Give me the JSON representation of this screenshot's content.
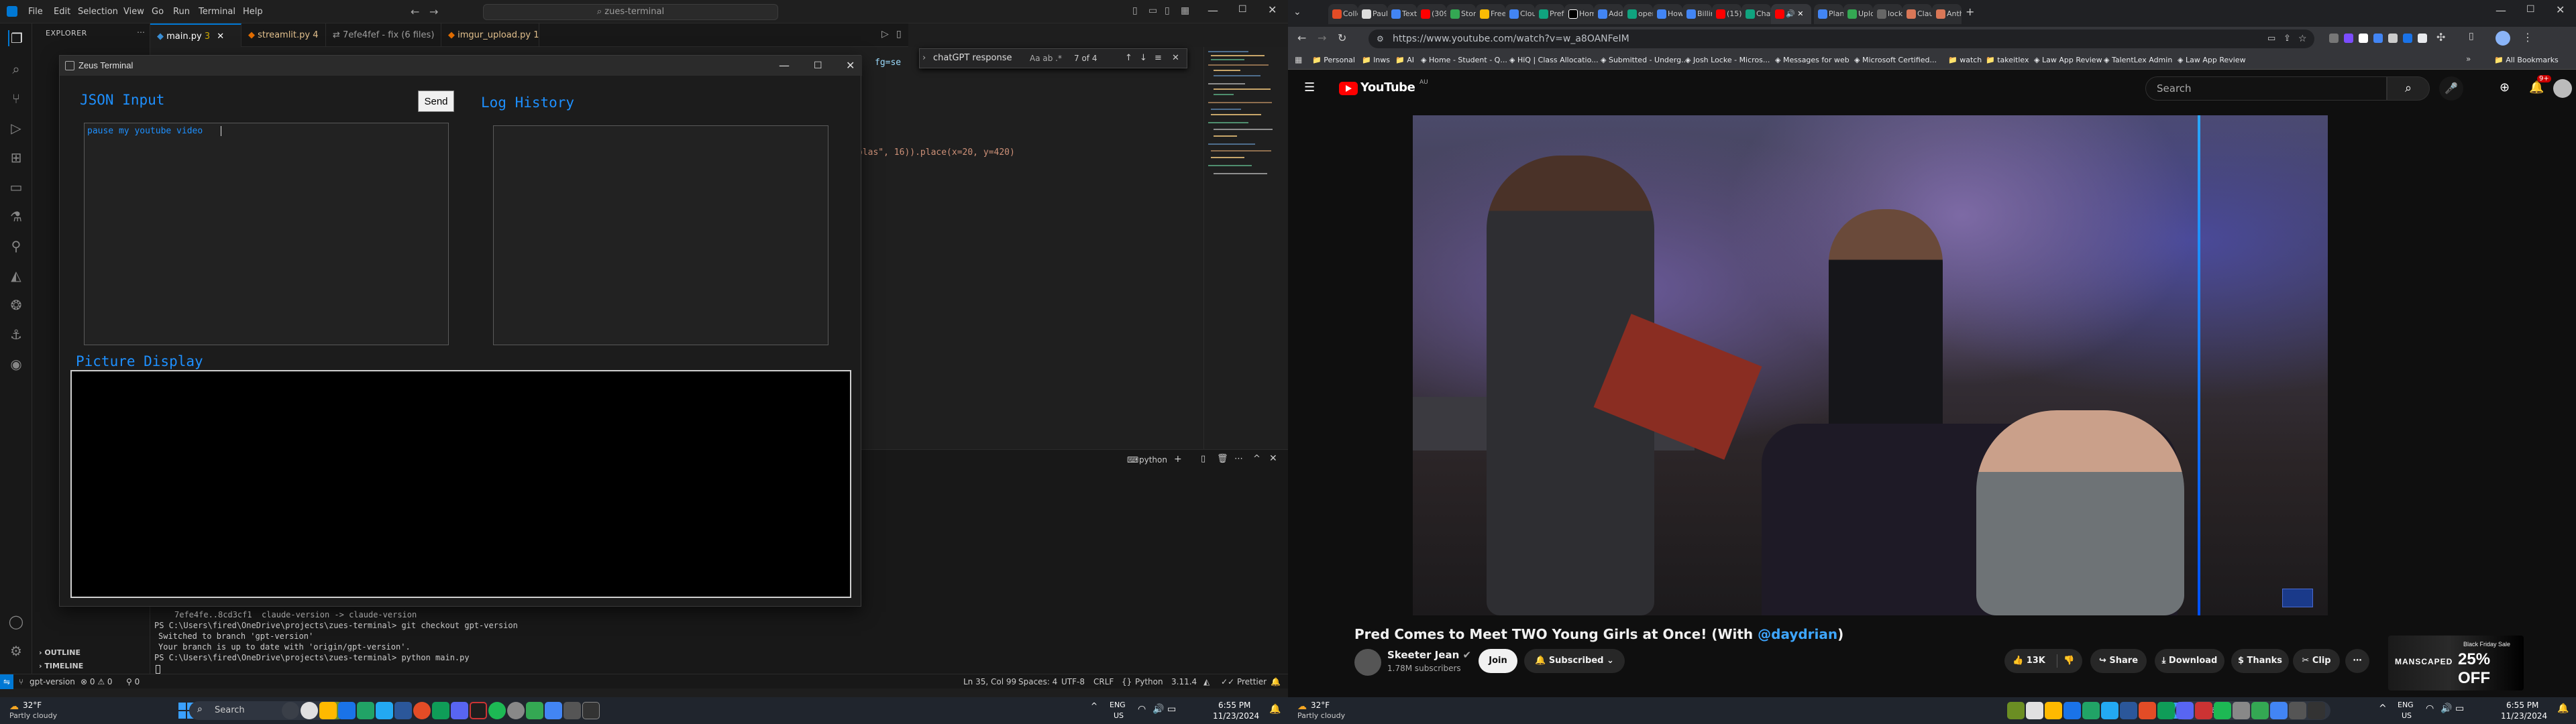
{
  "vscode": {
    "menu": [
      "File",
      "Edit",
      "Selection",
      "View",
      "Go",
      "Run",
      "Terminal",
      "Help"
    ],
    "command_center": "zues-terminal",
    "explorer_title": "EXPLORER",
    "outline": "OUTLINE",
    "timeline": "TIMELINE",
    "tabs": [
      {
        "label": "main.py",
        "badge": "3",
        "active": true
      },
      {
        "label": "streamlit.py",
        "badge": "4",
        "active": false
      },
      {
        "label": "7efe4fef - fix (6 files)",
        "badge": "",
        "active": false
      },
      {
        "label": "imgur_upload.py",
        "badge": "1",
        "active": false
      }
    ],
    "find": {
      "query": "chatGPT response",
      "options": "Aa ab .*",
      "count": "7 of 4"
    },
    "code_fragments": {
      "fg": "fg=se",
      "place": "olas\", 16)).place(x=20, y=420)"
    },
    "panel_label": "python",
    "terminal_lines": [
      "7efe4fe..8cd3cf1  claude-version -> claude-version",
      "PS C:\\Users\\fired\\OneDrive\\projects\\zues-terminal> git checkout gpt-version",
      "Switched to branch 'gpt-version'",
      "Your branch is up to date with 'origin/gpt-version'.",
      "PS C:\\Users\\fired\\OneDrive\\projects\\zues-terminal> python main.py"
    ],
    "status": {
      "branch": "gpt-version",
      "problems": "⊗ 0 ⚠ 0",
      "ports": "⚲ 0",
      "position": "Ln 35, Col 99",
      "spaces": "Spaces: 4",
      "encoding": "UTF-8",
      "eol": "CRLF",
      "language": "Python",
      "version": "3.11.4",
      "formatter": "Prettier"
    }
  },
  "zeus": {
    "title": "Zeus Terminal",
    "json_input_label": "JSON Input",
    "send_label": "Send",
    "input_text": "pause my youtube video",
    "log_history_label": "Log History",
    "picture_display_label": "Picture Display"
  },
  "taskbar_left": {
    "weather_temp": "32°F",
    "weather_desc": "Partly cloudy",
    "search_placeholder": "Search",
    "lang": "ENG",
    "region": "US",
    "time": "6:55 PM",
    "date": "11/23/2024"
  },
  "chrome": {
    "url": "https://www.youtube.com/watch?v=w_a8OANFeIM",
    "tabs": [
      "Colle",
      "Paul",
      "Text",
      "(309)",
      "Stora",
      "Free",
      "Clou",
      "Prefe",
      "Hom",
      "Add",
      "open",
      "How",
      "Billin",
      "(15)",
      "Chat",
      "",
      "Plane",
      "Uplo",
      "locks",
      "Clau",
      "Anth"
    ],
    "bookmarks": [
      "Personal",
      "lnws",
      "AI",
      "Home - Student - Q...",
      "HiQ | Class Allocatio...",
      "Submitted - Underg...",
      "Josh Locke - Micros...",
      "Messages for web",
      "Microsoft Certified...",
      "watch",
      "takeitlex",
      "Law App Review",
      "TalentLex Admin",
      "Law App Review"
    ],
    "all_bookmarks": "All Bookmarks"
  },
  "youtube": {
    "logo": "YouTube",
    "logo_region": "AU",
    "search_placeholder": "Search",
    "notifications": "9+",
    "video_title_main": "Pred Comes to Meet TWO Young Girls at Once! (With ",
    "video_title_link": "@daydrian",
    "video_title_end": ")",
    "channel": "Skeeter Jean",
    "subscribers": "1.78M subscribers",
    "join": "Join",
    "subscribed": "Subscribed",
    "likes": "13K",
    "share": "Share",
    "download": "Download",
    "thanks": "Thanks",
    "clip": "Clip",
    "ad": {
      "brand": "MANSCAPED",
      "sale": "Black Friday Sale",
      "offer": "25% OFF"
    }
  },
  "taskbar_right": {
    "weather_temp": "32°F",
    "weather_desc": "Partly cloudy",
    "search_placeholder": "Search",
    "lang": "ENG",
    "region": "US",
    "time": "6:55 PM",
    "date": "11/23/2024"
  },
  "colors": {
    "accent": "#0078d4",
    "zeus_label": "#1e90ff",
    "youtube_red": "#ff0000"
  }
}
